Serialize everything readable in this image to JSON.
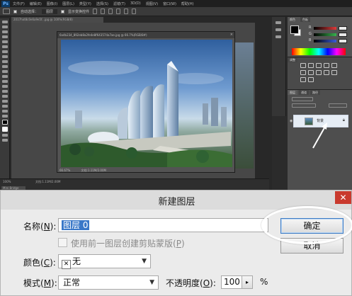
{
  "photoshop": {
    "logo": "Ps",
    "menus": [
      "文件(F)",
      "编辑(E)",
      "图像(I)",
      "图层(L)",
      "类型(Y)",
      "选择(S)",
      "滤镜(T)",
      "3D(D)",
      "视图(V)",
      "窗口(W)",
      "帮助(H)"
    ],
    "options": {
      "auto_select_label": "自动选择：",
      "auto_select_value": "图层",
      "show_transform_label": "显示变换控件"
    },
    "back_tab_title": "2017hot8c0e6a9e5f...jpg @ 100%(RGB/8)",
    "document": {
      "title": "6a4b234_892eb8a2fe4e8f643574a7ae.jpg @ 66.7%(RGB/8#)",
      "zoom": "66.67%",
      "doc_size": "文档:1.11M/2.00M"
    },
    "bottom": {
      "zoom": "100%",
      "doc_size": "文档:1.11M/2.00M",
      "tab": "Mini Bridge"
    },
    "color_panel": {
      "tab_color": "颜色",
      "tab_swatches": "色板",
      "r_label": "R",
      "g_label": "G",
      "b_label": "B",
      "r_color": "#e03b3b",
      "g_color": "#37b24d",
      "b_color": "#3a5bd9"
    },
    "adjust_panel": {
      "tab": "调整",
      "icons": [
        "brightness-icon",
        "levels-icon",
        "curves-icon",
        "exposure-icon",
        "vibrance-icon",
        "hue-icon",
        "balance-icon",
        "bw-icon",
        "photo-filter-icon",
        "channel-mixer-icon",
        "lookup-icon",
        "invert-icon"
      ]
    },
    "layers_panel": {
      "tab_layers": "图层",
      "tab_channels": "通道",
      "tab_paths": "路径",
      "layer_name": "背景",
      "lock_icon": "lock-icon"
    }
  },
  "dialog": {
    "title": "新建图层",
    "close": "✕",
    "name_label_prefix": "名称(",
    "name_hotkey": "N",
    "name_label_suffix": "):",
    "name_value": "图层 0",
    "clipping_label_prefix": "使用前一图层创建剪贴蒙版(",
    "clipping_hotkey": "P",
    "clipping_label_suffix": ")",
    "color_label_prefix": "颜色(",
    "color_hotkey": "C",
    "color_label_suffix": "):",
    "color_value": "无",
    "mode_label_prefix": "模式(",
    "mode_hotkey": "M",
    "mode_label_suffix": "):",
    "mode_value": "正常",
    "opacity_label_prefix": "不透明度(",
    "opacity_hotkey": "O",
    "opacity_label_suffix": "):",
    "opacity_value": "100",
    "opacity_unit": "%",
    "ok_label": "确定",
    "cancel_label": "取消"
  }
}
